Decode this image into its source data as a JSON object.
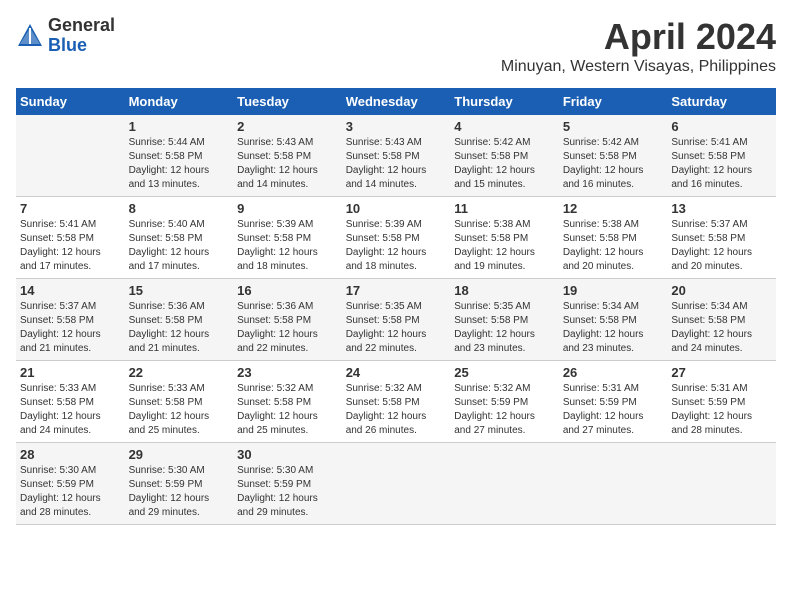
{
  "logo": {
    "general": "General",
    "blue": "Blue"
  },
  "title": "April 2024",
  "subtitle": "Minuyan, Western Visayas, Philippines",
  "days_header": [
    "Sunday",
    "Monday",
    "Tuesday",
    "Wednesday",
    "Thursday",
    "Friday",
    "Saturday"
  ],
  "weeks": [
    [
      {
        "num": "",
        "info": ""
      },
      {
        "num": "1",
        "info": "Sunrise: 5:44 AM\nSunset: 5:58 PM\nDaylight: 12 hours\nand 13 minutes."
      },
      {
        "num": "2",
        "info": "Sunrise: 5:43 AM\nSunset: 5:58 PM\nDaylight: 12 hours\nand 14 minutes."
      },
      {
        "num": "3",
        "info": "Sunrise: 5:43 AM\nSunset: 5:58 PM\nDaylight: 12 hours\nand 14 minutes."
      },
      {
        "num": "4",
        "info": "Sunrise: 5:42 AM\nSunset: 5:58 PM\nDaylight: 12 hours\nand 15 minutes."
      },
      {
        "num": "5",
        "info": "Sunrise: 5:42 AM\nSunset: 5:58 PM\nDaylight: 12 hours\nand 16 minutes."
      },
      {
        "num": "6",
        "info": "Sunrise: 5:41 AM\nSunset: 5:58 PM\nDaylight: 12 hours\nand 16 minutes."
      }
    ],
    [
      {
        "num": "7",
        "info": "Sunrise: 5:41 AM\nSunset: 5:58 PM\nDaylight: 12 hours\nand 17 minutes."
      },
      {
        "num": "8",
        "info": "Sunrise: 5:40 AM\nSunset: 5:58 PM\nDaylight: 12 hours\nand 17 minutes."
      },
      {
        "num": "9",
        "info": "Sunrise: 5:39 AM\nSunset: 5:58 PM\nDaylight: 12 hours\nand 18 minutes."
      },
      {
        "num": "10",
        "info": "Sunrise: 5:39 AM\nSunset: 5:58 PM\nDaylight: 12 hours\nand 18 minutes."
      },
      {
        "num": "11",
        "info": "Sunrise: 5:38 AM\nSunset: 5:58 PM\nDaylight: 12 hours\nand 19 minutes."
      },
      {
        "num": "12",
        "info": "Sunrise: 5:38 AM\nSunset: 5:58 PM\nDaylight: 12 hours\nand 20 minutes."
      },
      {
        "num": "13",
        "info": "Sunrise: 5:37 AM\nSunset: 5:58 PM\nDaylight: 12 hours\nand 20 minutes."
      }
    ],
    [
      {
        "num": "14",
        "info": "Sunrise: 5:37 AM\nSunset: 5:58 PM\nDaylight: 12 hours\nand 21 minutes."
      },
      {
        "num": "15",
        "info": "Sunrise: 5:36 AM\nSunset: 5:58 PM\nDaylight: 12 hours\nand 21 minutes."
      },
      {
        "num": "16",
        "info": "Sunrise: 5:36 AM\nSunset: 5:58 PM\nDaylight: 12 hours\nand 22 minutes."
      },
      {
        "num": "17",
        "info": "Sunrise: 5:35 AM\nSunset: 5:58 PM\nDaylight: 12 hours\nand 22 minutes."
      },
      {
        "num": "18",
        "info": "Sunrise: 5:35 AM\nSunset: 5:58 PM\nDaylight: 12 hours\nand 23 minutes."
      },
      {
        "num": "19",
        "info": "Sunrise: 5:34 AM\nSunset: 5:58 PM\nDaylight: 12 hours\nand 23 minutes."
      },
      {
        "num": "20",
        "info": "Sunrise: 5:34 AM\nSunset: 5:58 PM\nDaylight: 12 hours\nand 24 minutes."
      }
    ],
    [
      {
        "num": "21",
        "info": "Sunrise: 5:33 AM\nSunset: 5:58 PM\nDaylight: 12 hours\nand 24 minutes."
      },
      {
        "num": "22",
        "info": "Sunrise: 5:33 AM\nSunset: 5:58 PM\nDaylight: 12 hours\nand 25 minutes."
      },
      {
        "num": "23",
        "info": "Sunrise: 5:32 AM\nSunset: 5:58 PM\nDaylight: 12 hours\nand 25 minutes."
      },
      {
        "num": "24",
        "info": "Sunrise: 5:32 AM\nSunset: 5:58 PM\nDaylight: 12 hours\nand 26 minutes."
      },
      {
        "num": "25",
        "info": "Sunrise: 5:32 AM\nSunset: 5:59 PM\nDaylight: 12 hours\nand 27 minutes."
      },
      {
        "num": "26",
        "info": "Sunrise: 5:31 AM\nSunset: 5:59 PM\nDaylight: 12 hours\nand 27 minutes."
      },
      {
        "num": "27",
        "info": "Sunrise: 5:31 AM\nSunset: 5:59 PM\nDaylight: 12 hours\nand 28 minutes."
      }
    ],
    [
      {
        "num": "28",
        "info": "Sunrise: 5:30 AM\nSunset: 5:59 PM\nDaylight: 12 hours\nand 28 minutes."
      },
      {
        "num": "29",
        "info": "Sunrise: 5:30 AM\nSunset: 5:59 PM\nDaylight: 12 hours\nand 29 minutes."
      },
      {
        "num": "30",
        "info": "Sunrise: 5:30 AM\nSunset: 5:59 PM\nDaylight: 12 hours\nand 29 minutes."
      },
      {
        "num": "",
        "info": ""
      },
      {
        "num": "",
        "info": ""
      },
      {
        "num": "",
        "info": ""
      },
      {
        "num": "",
        "info": ""
      }
    ]
  ]
}
